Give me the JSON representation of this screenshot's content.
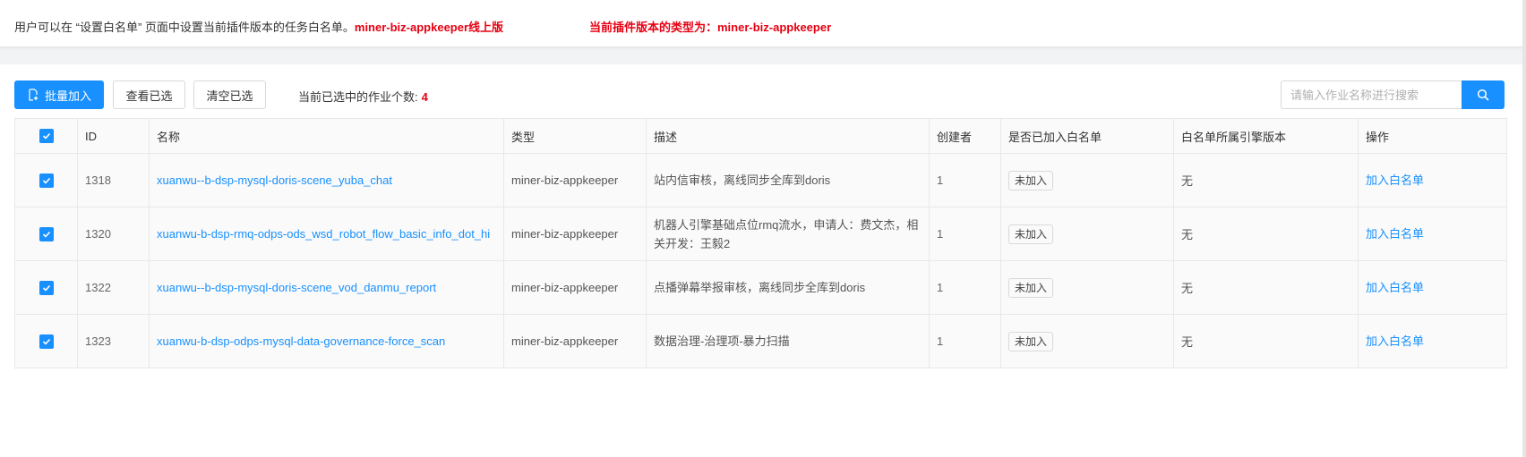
{
  "notice": {
    "prefix": "用户可以在 “设置白名单” 页面中设置当前插件版本的任务白名单。",
    "highlight": "miner-biz-appkeeper线上版",
    "plugin_type": "当前插件版本的类型为：miner-biz-appkeeper"
  },
  "toolbar": {
    "batch_add_label": "批量加入",
    "view_selected_label": "查看已选",
    "clear_selected_label": "清空已选",
    "selected_count_label": "当前已选中的作业个数:",
    "selected_count": "4"
  },
  "search": {
    "placeholder": "请输入作业名称进行搜索"
  },
  "table": {
    "headers": {
      "id": "ID",
      "name": "名称",
      "type": "类型",
      "desc": "描述",
      "creator": "创建者",
      "added": "是否已加入白名单",
      "version": "白名单所属引擎版本",
      "op": "操作"
    },
    "rows": [
      {
        "id": "1318",
        "name": "xuanwu--b-dsp-mysql-doris-scene_yuba_chat",
        "type": "miner-biz-appkeeper",
        "desc": "站内信审核，离线同步全库到doris",
        "creator": "1",
        "added": "未加入",
        "version": "无",
        "op": "加入白名单"
      },
      {
        "id": "1320",
        "name": "xuanwu-b-dsp-rmq-odps-ods_wsd_robot_flow_basic_info_dot_hi",
        "type": "miner-biz-appkeeper",
        "desc": "机器人引擎基础点位rmq流水，申请人：费文杰，相关开发：王毅2",
        "creator": "1",
        "added": "未加入",
        "version": "无",
        "op": "加入白名单"
      },
      {
        "id": "1322",
        "name": "xuanwu--b-dsp-mysql-doris-scene_vod_danmu_report",
        "type": "miner-biz-appkeeper",
        "desc": "点播弹幕举报审核，离线同步全库到doris",
        "creator": "1",
        "added": "未加入",
        "version": "无",
        "op": "加入白名单"
      },
      {
        "id": "1323",
        "name": "xuanwu-b-dsp-odps-mysql-data-governance-force_scan",
        "type": "miner-biz-appkeeper",
        "desc": "数据治理-治理项-暴力扫描",
        "creator": "1",
        "added": "未加入",
        "version": "无",
        "op": "加入白名单"
      }
    ]
  },
  "colors": {
    "primary": "#1890ff",
    "highlight_red": "#e60012"
  },
  "icons": {
    "batch_add": "file-add-icon",
    "search": "search-icon",
    "checkbox": "checkbox-checked-icon"
  }
}
